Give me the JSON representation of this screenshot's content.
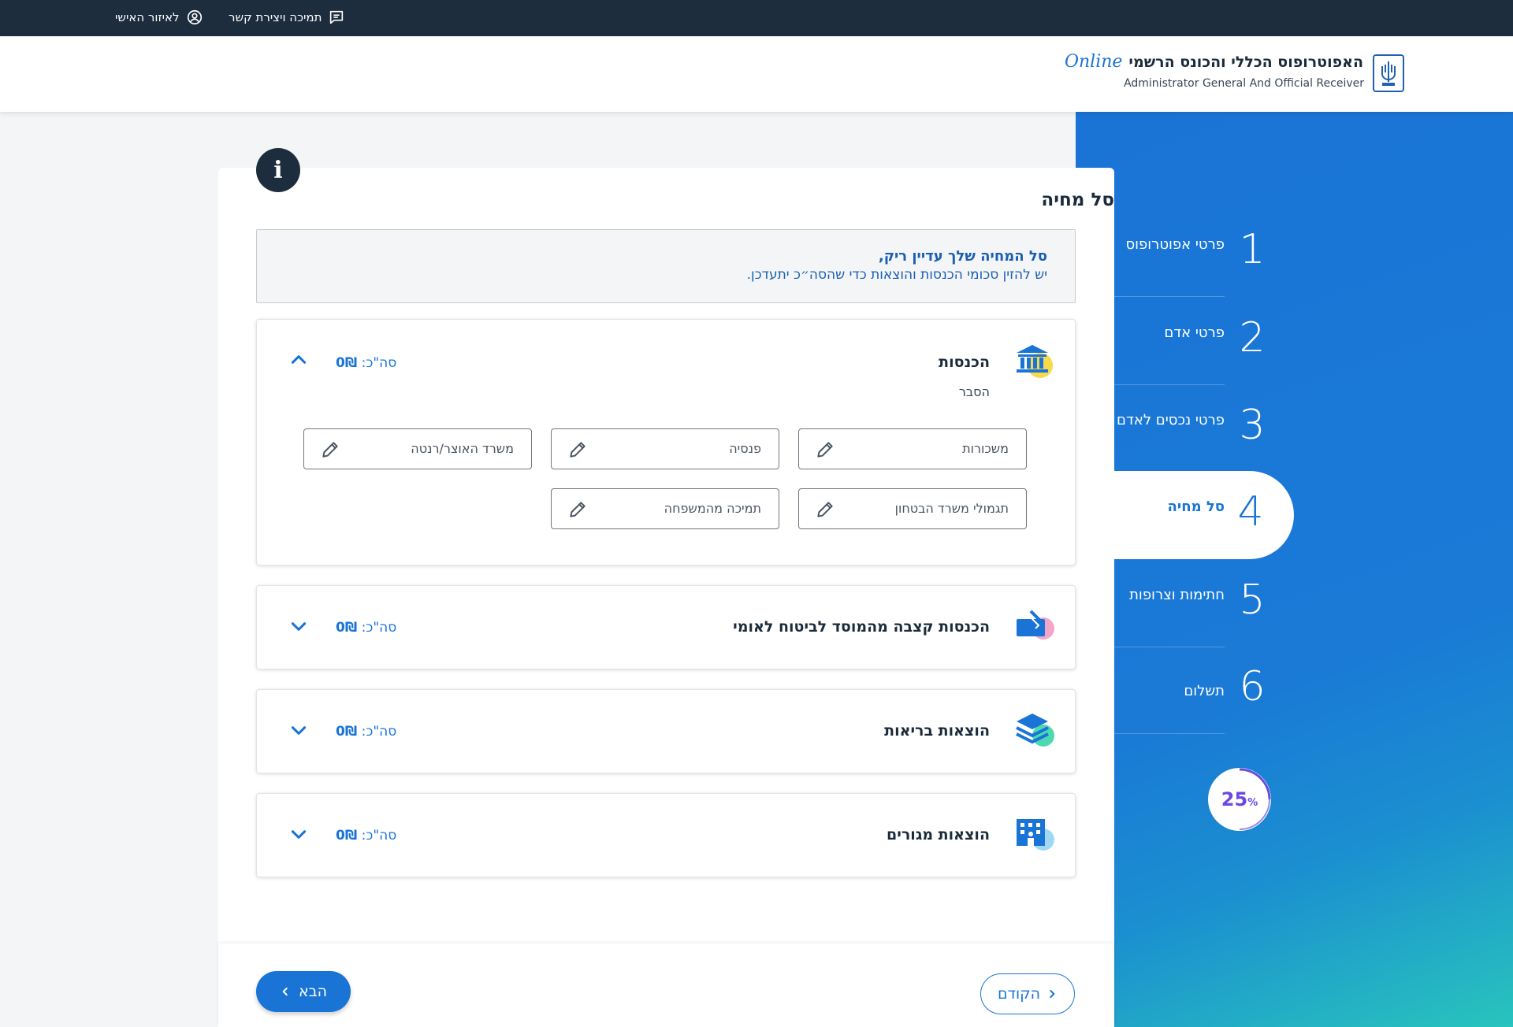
{
  "topbar": {
    "support_label": "תמיכה ויצירת קשר",
    "personal_label": "לאיזור האישי"
  },
  "header": {
    "title_he": "האפוטרופוס הכללי והכונס הרשמי",
    "title_online": "Online",
    "subtitle_en": "Administrator General And Official Receiver"
  },
  "steps": [
    {
      "number": "1",
      "label": "פרטי אפוטרופוס"
    },
    {
      "number": "2",
      "label": "פרטי אדם"
    },
    {
      "number": "3",
      "label": "פרטי נכסים לאדם"
    },
    {
      "number": "4",
      "label": "סל מחיה",
      "active": true
    },
    {
      "number": "5",
      "label": "חתימות וצרופות"
    },
    {
      "number": "6",
      "label": "תשלום"
    }
  ],
  "progress": {
    "value": 25,
    "percent_sign": "%"
  },
  "main": {
    "title": "סל מחיה",
    "notice_title": "סל המחיה שלך עדיין ריק,",
    "notice_text": "יש להזין סכומי הכנסות והוצאות כדי שהסה״כ יתעדכן."
  },
  "sections": [
    {
      "title": "הכנסות",
      "total_prefix": "סה\"כ:",
      "total_value": "0₪",
      "expanded": true,
      "explain": "הסבר",
      "fields": [
        "משכורות",
        "פנסיה",
        "משרד האוצר/רנטה",
        "תגמולי משרד הבטחון",
        "תמיכה מהמשפחה"
      ],
      "icon": "bank-icon",
      "icon_color": "#f7d94c"
    },
    {
      "title": "הכנסות קצבה מהמוסד לביטוח לאומי",
      "total_prefix": "סה\"כ:",
      "total_value": "0₪",
      "expanded": false,
      "icon": "allowance-icon",
      "icon_color": "#f4a6c8"
    },
    {
      "title": "הוצאות בריאות",
      "total_prefix": "סה\"כ:",
      "total_value": "0₪",
      "expanded": false,
      "icon": "layers-icon",
      "icon_color": "#4dd9b0"
    },
    {
      "title": "הוצאות מגורים",
      "total_prefix": "סה\"כ:",
      "total_value": "0₪",
      "expanded": false,
      "icon": "building-icon",
      "icon_color": "#9fd8f5"
    }
  ],
  "footer": {
    "next_label": "הבא",
    "prev_label": "הקודם"
  },
  "colors": {
    "primary": "#1a74d6",
    "dark": "#1d2d3e"
  }
}
